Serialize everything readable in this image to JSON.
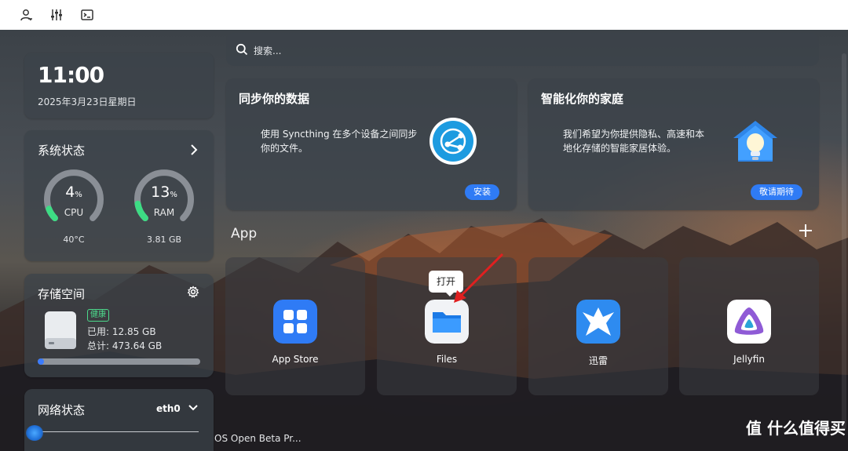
{
  "toolbar": {
    "icons": [
      "user-icon",
      "sliders-icon",
      "terminal-icon"
    ]
  },
  "search": {
    "placeholder": "搜索..."
  },
  "clock": {
    "time": "11:00",
    "date": "2025年3月23日星期日"
  },
  "system_status": {
    "title": "系统状态",
    "cpu": {
      "value": "4",
      "unit": "%",
      "label": "CPU",
      "sub": "40°C",
      "fraction": 0.04
    },
    "ram": {
      "value": "13",
      "unit": "%",
      "label": "RAM",
      "sub": "3.81 GB",
      "fraction": 0.13
    }
  },
  "storage": {
    "title": "存储空间",
    "badge": "健康",
    "used": "已用: 12.85 GB",
    "total": "总计: 473.64 GB",
    "used_fraction": 0.027
  },
  "network": {
    "title": "网络状态",
    "interface": "eth0"
  },
  "promo_sync": {
    "title": "同步你的数据",
    "desc_line1": "使用 Syncthing 在多个设备之间同步",
    "desc_line2": "你的文件。",
    "button": "安装"
  },
  "promo_home": {
    "title": "智能化你的家庭",
    "desc_line1": "我们希望为你提供隐私、高速和本",
    "desc_line2": "地化存储的智能家居体验。",
    "button": "敬请期待"
  },
  "apps": {
    "section_title": "App",
    "tooltip": "打开",
    "items": [
      {
        "name": "App Store",
        "icon": "app-store-icon"
      },
      {
        "name": "Files",
        "icon": "folder-icon"
      },
      {
        "name": "迅雷",
        "icon": "thunder-bird-icon"
      },
      {
        "name": "Jellyfin",
        "icon": "jellyfin-icon"
      }
    ]
  },
  "footer": {
    "text": "OS Open Beta Pr..."
  },
  "watermark": {
    "text": "值 什么值得买"
  },
  "colors": {
    "accent": "#2f7bf5",
    "healthy": "#4cd98b",
    "gauge_fill": "#3ddc84"
  }
}
